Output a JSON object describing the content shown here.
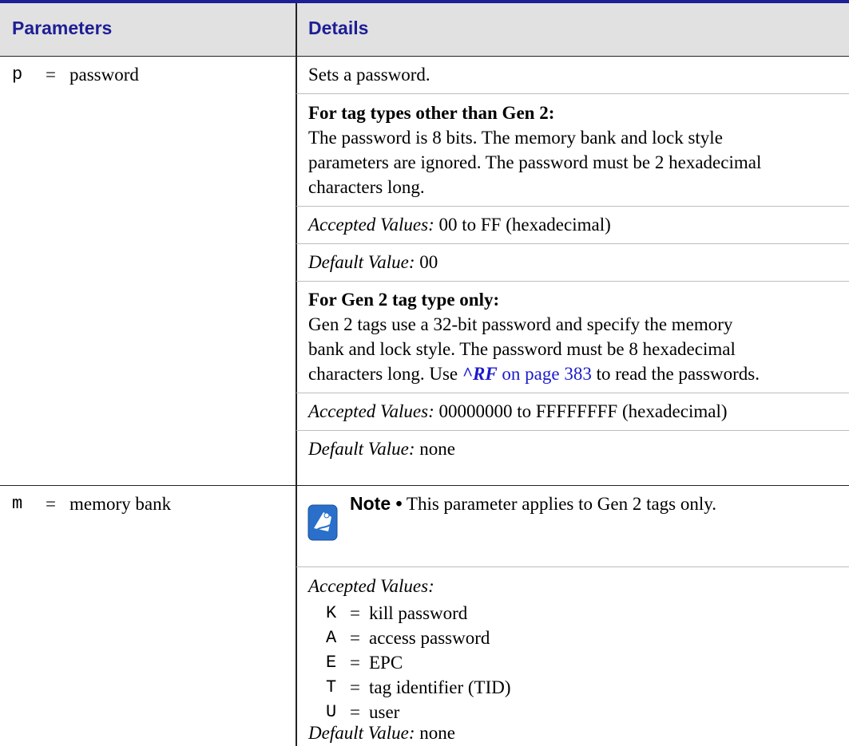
{
  "table": {
    "header": {
      "col1": "Parameters",
      "col2": "Details"
    },
    "row_p": {
      "param_code": "p",
      "param_eq": "=",
      "param_name": "password",
      "intro": "Sets a password.",
      "gen1_heading": "For tag types other than Gen 2:",
      "gen1_lines": [
        "The password is 8 bits. The memory bank and lock style",
        "parameters are ignored. The password must be 2 hexadecimal",
        "characters long."
      ],
      "gen1_accepted_label": "Accepted Values:",
      "gen1_accepted_value": "00 to FF (hexadecimal)",
      "gen1_default_label": "Default Value:",
      "gen1_default_value": "00",
      "gen2_heading": "For Gen 2 tag type only:",
      "gen2_lines": [
        "Gen 2 tags use a 32-bit password and specify the memory",
        "bank and lock style. The password must be 8 hexadecimal"
      ],
      "gen2_last_line_pre": "characters long. Use ",
      "gen2_link_cmd": "^RF",
      "gen2_link_page": " on page 383",
      "gen2_last_line_post": " to read the passwords.",
      "gen2_accepted_label": "Accepted Values:",
      "gen2_accepted_value": "00000000 to FFFFFFFF (hexadecimal)",
      "gen2_default_label": "Default Value:",
      "gen2_default_value": "none"
    },
    "row_m": {
      "param_code": "m",
      "param_eq": "=",
      "param_name": "memory bank",
      "note_label": "Note •",
      "note_text": "This parameter applies to Gen 2 tags only.",
      "note_icon": "note-pad-icon",
      "accepted_label": "Accepted Values:",
      "values": [
        {
          "code": "K",
          "eq": "=",
          "desc": "kill password"
        },
        {
          "code": "A",
          "eq": "=",
          "desc": "access password"
        },
        {
          "code": "E",
          "eq": "=",
          "desc": "EPC"
        },
        {
          "code": "T",
          "eq": "=",
          "desc": "tag identifier (TID)"
        },
        {
          "code": "U",
          "eq": "=",
          "desc": "user"
        }
      ],
      "default_label": "Default Value:",
      "default_value": "none"
    }
  },
  "colors": {
    "header_text": "#1e1e96",
    "header_bg": "#e1e1e1",
    "link": "#1a1acd",
    "icon": "#2a6fc9"
  }
}
